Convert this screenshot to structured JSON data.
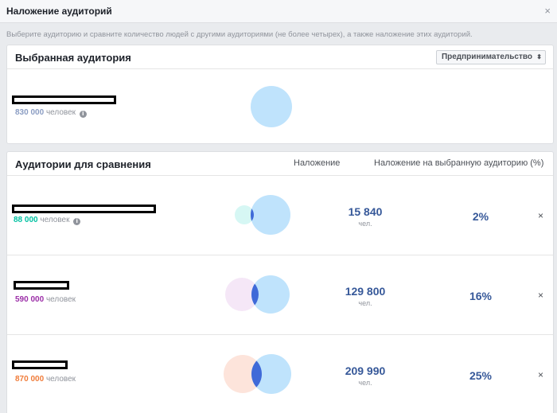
{
  "dialog": {
    "title": "Наложение аудиторий",
    "close_glyph": "×",
    "instructions": "Выберите аудиторию и сравните количество людей с другими аудиториями (не более четырех), а также наложение этих аудиторий."
  },
  "selected": {
    "title": "Выбранная аудитория",
    "dropdown_value": "Предпринимательство",
    "dropdown_caret": "⬍",
    "count": "830 000",
    "unit": "человек",
    "info_glyph": "i",
    "colors": {
      "count": "#8b9dc3",
      "circle": "#bfe3fc"
    }
  },
  "compare": {
    "title": "Аудитории для сравнения",
    "col_overlap": "Наложение",
    "col_pct": "Наложение на выбранную аудиторию (%)",
    "rows": [
      {
        "count": "88 000",
        "unit": "человек",
        "info_glyph": "i",
        "overlap": "15 840",
        "overlap_unit": "чел.",
        "pct": "2%",
        "remove_glyph": "×",
        "colors": {
          "count": "#00c1a2",
          "circle": "#d6f7f4",
          "intersection": "#3f6ad8"
        }
      },
      {
        "count": "590 000",
        "unit": "человек",
        "overlap": "129 800",
        "overlap_unit": "чел.",
        "pct": "16%",
        "remove_glyph": "×",
        "colors": {
          "count": "#9c2fa8",
          "circle": "#f5e7f7",
          "intersection": "#3f6ad8"
        }
      },
      {
        "count": "870 000",
        "unit": "человек",
        "overlap": "209 990",
        "overlap_unit": "чел.",
        "pct": "25%",
        "remove_glyph": "×",
        "colors": {
          "count": "#f07c3a",
          "circle": "#fde4db",
          "intersection": "#3f6ad8"
        }
      }
    ]
  }
}
